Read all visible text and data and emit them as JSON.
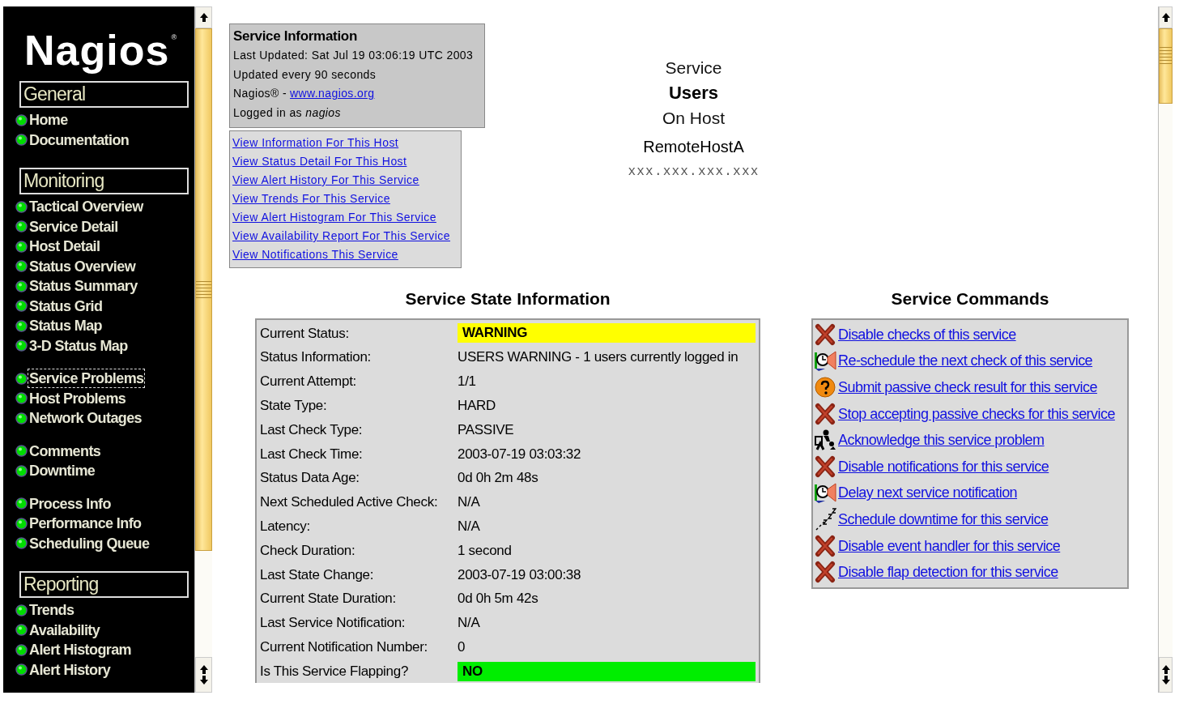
{
  "sidebar": {
    "logo": {
      "text": "Nagios",
      "mark": "®"
    },
    "sections": [
      {
        "title": "General",
        "groups": [
          {
            "items": [
              {
                "label": "Home",
                "focused": false
              },
              {
                "label": "Documentation",
                "focused": false
              }
            ]
          }
        ]
      },
      {
        "title": "Monitoring",
        "groups": [
          {
            "items": [
              {
                "label": "Tactical Overview",
                "focused": false
              },
              {
                "label": "Service Detail",
                "focused": false
              },
              {
                "label": "Host Detail",
                "focused": false
              },
              {
                "label": "Status Overview",
                "focused": false
              },
              {
                "label": "Status Summary",
                "focused": false
              },
              {
                "label": "Status Grid",
                "focused": false
              },
              {
                "label": "Status Map",
                "focused": false
              },
              {
                "label": "3-D Status Map",
                "focused": false
              }
            ]
          },
          {
            "items": [
              {
                "label": "Service Problems",
                "focused": true
              },
              {
                "label": "Host Problems",
                "focused": false
              },
              {
                "label": "Network Outages",
                "focused": false
              }
            ]
          },
          {
            "items": [
              {
                "label": "Comments",
                "focused": false
              },
              {
                "label": "Downtime",
                "focused": false
              }
            ]
          },
          {
            "items": [
              {
                "label": "Process Info",
                "focused": false
              },
              {
                "label": "Performance Info",
                "focused": false
              },
              {
                "label": "Scheduling Queue",
                "focused": false
              }
            ]
          }
        ]
      },
      {
        "title": "Reporting",
        "groups": [
          {
            "items": [
              {
                "label": "Trends",
                "focused": false
              },
              {
                "label": "Availability",
                "focused": false
              },
              {
                "label": "Alert Histogram",
                "focused": false
              },
              {
                "label": "Alert History",
                "focused": false
              }
            ]
          }
        ]
      }
    ]
  },
  "service_info": {
    "title": "Service Information",
    "last_updated": "Last Updated: Sat Jul 19 03:06:19 UTC 2003",
    "update_interval": "Updated every 90 seconds",
    "credit": {
      "text": "Nagios® -",
      "link": "www.nagios.org"
    },
    "logged_in": "Logged in as *nagios*"
  },
  "links": [
    "View Information For This Host",
    "View Status Detail For This Host",
    "View Alert History For This Service",
    "View Trends For This Service",
    "View Alert Histogram For This Service",
    "View Availability Report For This Service",
    "View Notifications This Service"
  ],
  "host_header": {
    "service_label": "Service",
    "service": "Users",
    "host_label": "On Host",
    "host": "RemoteHostA",
    "address": "xxx.xxx.xxx.xxx"
  },
  "state_info": {
    "title": "Service State Information",
    "rows": [
      {
        "label": "Current Status:",
        "value": "WARNING",
        "color": "#ffff00"
      },
      {
        "label": "Status Information:",
        "value": "USERS WARNING - 1 users currently logged in"
      },
      {
        "label": "Current Attempt:",
        "value": "1/1"
      },
      {
        "label": "State Type:",
        "value": "HARD"
      },
      {
        "label": "Last Check Type:",
        "value": "PASSIVE"
      },
      {
        "label": "Last Check Time:",
        "value": "2003-07-19 03:03:32"
      },
      {
        "label": "Status Data Age:",
        "value": "0d 0h 2m 48s"
      },
      {
        "label": "Next Scheduled Active Check:",
        "value": "N/A"
      },
      {
        "label": "Latency:",
        "value": "N/A"
      },
      {
        "label": "Check Duration:",
        "value": "1 second"
      },
      {
        "label": "Last State Change:",
        "value": "2003-07-19 03:00:38"
      },
      {
        "label": "Current State Duration:",
        "value": "0d 0h 5m 42s"
      },
      {
        "label": "Last Service Notification:",
        "value": "N/A"
      },
      {
        "label": "Current Notification Number:",
        "value": "0"
      },
      {
        "label": "Is This Service Flapping?",
        "value": "NO",
        "color": "#00ee00"
      }
    ]
  },
  "commands": {
    "title": "Service Commands",
    "items": [
      {
        "kind": "disable",
        "label": "Disable checks of this service"
      },
      {
        "kind": "reschedule",
        "label": "Re-schedule the next check of this service"
      },
      {
        "kind": "passive",
        "label": "Submit passive check result for this service"
      },
      {
        "kind": "disable",
        "label": "Stop accepting passive checks for this service"
      },
      {
        "kind": "acknowledge",
        "label": "Acknowledge this service problem"
      },
      {
        "kind": "disable",
        "label": "Disable notifications for this service"
      },
      {
        "kind": "reschedule",
        "label": "Delay next service notification"
      },
      {
        "kind": "downtime",
        "label": "Schedule downtime for this service"
      },
      {
        "kind": "disable",
        "label": "Disable event handler for this service"
      },
      {
        "kind": "disable",
        "label": "Disable flap detection for this service"
      }
    ]
  }
}
